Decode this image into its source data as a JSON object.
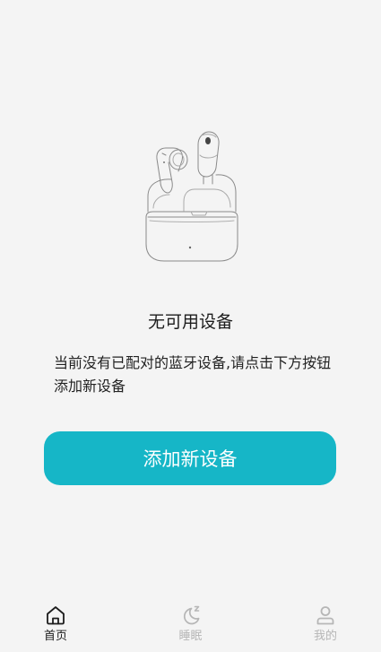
{
  "empty_state": {
    "illustration": "earbuds-case-illustration",
    "title": "无可用设备",
    "description": "当前没有已配对的蓝牙设备,请点击下方按钮添加新设备"
  },
  "add_button": {
    "label": "添加新设备",
    "color": "#16b6c7"
  },
  "tabbar": {
    "active_color": "#1c1c1c",
    "inactive_color": "#b6b6b6",
    "tabs": [
      {
        "label": "首页",
        "icon": "home-icon",
        "active": true
      },
      {
        "label": "睡眠",
        "icon": "sleep-moon-icon",
        "active": false
      },
      {
        "label": "我的",
        "icon": "user-profile-icon",
        "active": false
      }
    ]
  }
}
